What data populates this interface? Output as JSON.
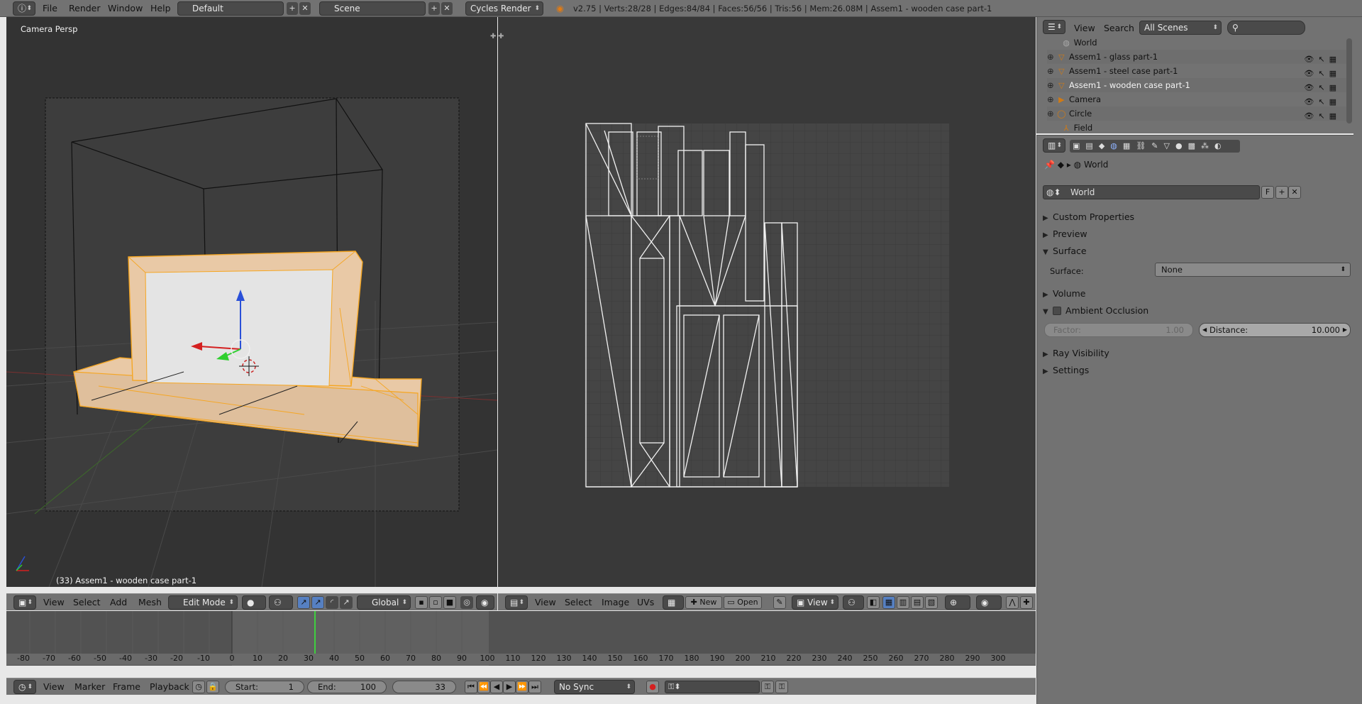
{
  "topbar": {
    "menus": [
      "File",
      "Render",
      "Window",
      "Help"
    ],
    "layout_name": "Default",
    "scene_name": "Scene",
    "engine": "Cycles Render",
    "stats": "v2.75 | Verts:28/28 | Edges:84/84 | Faces:56/56 | Tris:56 | Mem:26.08M | Assem1 - wooden case part-1"
  },
  "viewport3d": {
    "view_label": "Camera Persp",
    "object_label": "(33) Assem1 - wooden case part-1",
    "header": {
      "menus": [
        "View",
        "Select",
        "Add",
        "Mesh"
      ],
      "mode": "Edit Mode",
      "orientation": "Global"
    }
  },
  "uv_editor": {
    "header": {
      "menus": [
        "View",
        "Select",
        "Image",
        "UVs"
      ],
      "new_label": "New",
      "open_label": "Open",
      "view_label": "View"
    }
  },
  "outliner": {
    "menus": [
      "View",
      "Search"
    ],
    "scene_filter": "All Scenes",
    "items": [
      {
        "name": "World",
        "icon": "world-icon"
      },
      {
        "name": "Assem1 - glass part-1",
        "icon": "mesh-object-icon"
      },
      {
        "name": "Assem1 - steel case part-1",
        "icon": "mesh-object-icon"
      },
      {
        "name": "Assem1 - wooden case part-1",
        "icon": "mesh-object-icon"
      },
      {
        "name": "Camera",
        "icon": "camera-object-icon"
      },
      {
        "name": "Circle",
        "icon": "curve-object-icon"
      },
      {
        "name": "Field",
        "icon": "field-object-icon"
      }
    ]
  },
  "properties": {
    "breadcrumb": "World",
    "datablock_name": "World",
    "datablock_f": "F",
    "panels": {
      "custom_properties": "Custom Properties",
      "preview": "Preview",
      "surface": "Surface",
      "surface_label": "Surface:",
      "surface_value": "None",
      "volume": "Volume",
      "ambient_occlusion": "Ambient Occlusion",
      "factor_label": "Factor:",
      "factor_value": "1.00",
      "distance_label": "Distance:",
      "distance_value": "10.000",
      "ray_visibility": "Ray Visibility",
      "settings": "Settings"
    }
  },
  "timeline": {
    "ruler_labels": [
      "-80",
      "-70",
      "-60",
      "-50",
      "-40",
      "-30",
      "-20",
      "-10",
      "0",
      "10",
      "20",
      "30",
      "40",
      "50",
      "60",
      "70",
      "80",
      "90",
      "100",
      "110",
      "120",
      "130",
      "140",
      "150",
      "160",
      "170",
      "180",
      "190",
      "200",
      "210",
      "220",
      "230",
      "240",
      "250",
      "260",
      "270",
      "280",
      "290",
      "300"
    ],
    "menus": [
      "View",
      "Marker",
      "Frame",
      "Playback"
    ],
    "start_label": "Start:",
    "start_value": "1",
    "end_label": "End:",
    "end_value": "100",
    "current_frame": "33",
    "sync": "No Sync"
  },
  "colors": {
    "header_bg": "#727272",
    "viewport_bg": "#393939",
    "selection_orange": "#f5a623",
    "playhead_green": "#3fcf3f"
  }
}
